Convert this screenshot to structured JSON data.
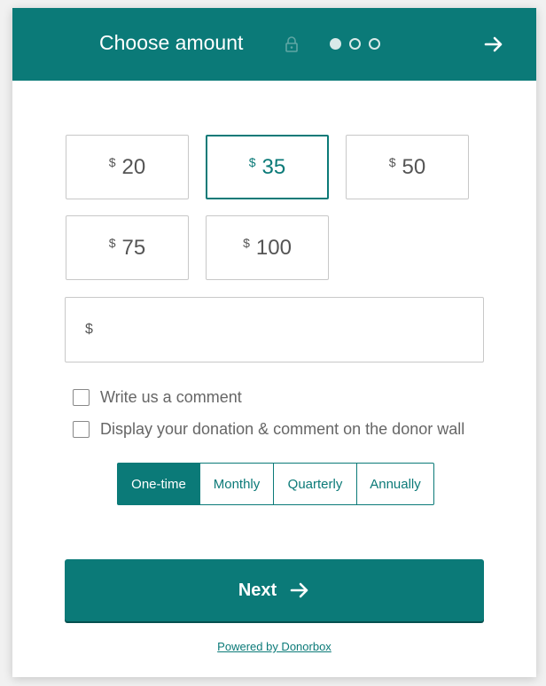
{
  "header": {
    "title": "Choose amount",
    "lock_icon": "lock-icon",
    "steps_total": 3,
    "step_current": 1,
    "next_icon": "arrow-right-icon"
  },
  "amounts": [
    {
      "currency": "$",
      "value": "20",
      "selected": false
    },
    {
      "currency": "$",
      "value": "35",
      "selected": true
    },
    {
      "currency": "$",
      "value": "50",
      "selected": false
    },
    {
      "currency": "$",
      "value": "75",
      "selected": false
    },
    {
      "currency": "$",
      "value": "100",
      "selected": false
    }
  ],
  "custom_amount": {
    "currency": "$",
    "value": "",
    "placeholder": ""
  },
  "options": {
    "comment_label": "Write us a comment",
    "donor_wall_label": "Display your donation & comment on the donor wall"
  },
  "frequency": {
    "options": [
      "One-time",
      "Monthly",
      "Quarterly",
      "Annually"
    ],
    "selected": "One-time"
  },
  "next_button": {
    "label": "Next"
  },
  "footer": {
    "powered_by": "Powered by Donorbox"
  },
  "colors": {
    "brand": "#0b7a78",
    "border": "#c8c8c8",
    "text": "#555555"
  }
}
